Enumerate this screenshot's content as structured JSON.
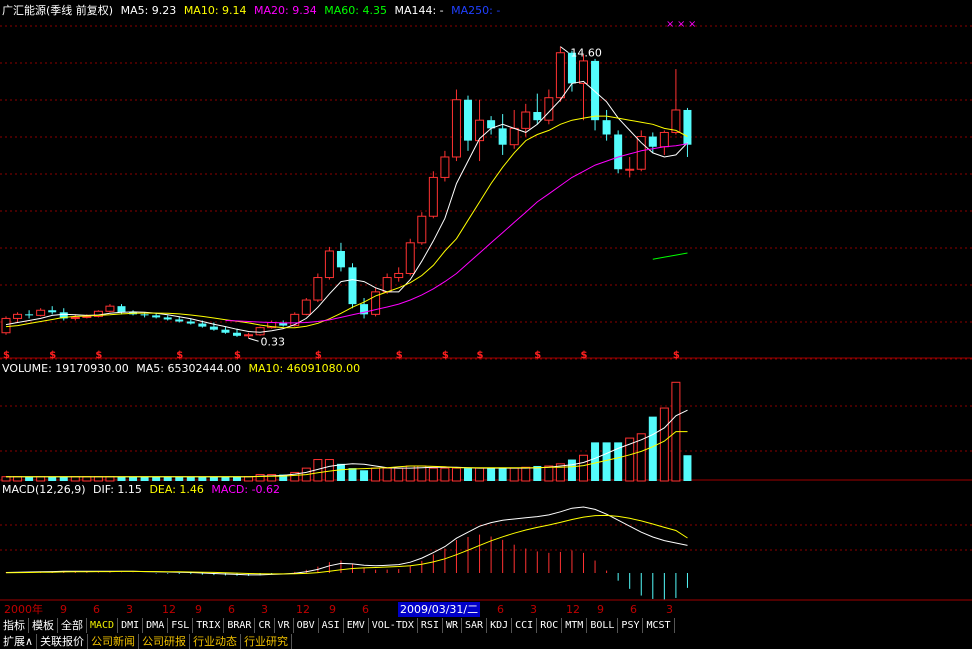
{
  "price_header": {
    "title": "广汇能源(季线 前复权)",
    "ma5": "MA5: 9.23",
    "ma10": "MA10: 9.14",
    "ma20": "MA20: 9.34",
    "ma60": "MA60: 4.35",
    "ma144": "MA144: -",
    "ma250": "MA250: -"
  },
  "volume_header": {
    "volume": "VOLUME: 19170930.00",
    "ma5": "MA5: 65302444.00",
    "ma10": "MA10: 46091080.00"
  },
  "macd_header": {
    "name": "MACD(12,26,9)",
    "dif": "DIF: 1.15",
    "dea": "DEA: 1.46",
    "macd": "MACD: -0.62"
  },
  "annotations": {
    "high": "14.60",
    "low": "0.33"
  },
  "colors": {
    "up": "#ff3232",
    "down": "#54fcfc",
    "ma5": "#ffffff",
    "ma10": "#ffff00",
    "ma20": "#ff00ff",
    "ma60": "#00ff00",
    "ma144": "#c0c0c0",
    "ma250": "#2040ff",
    "grid": "#8b0000",
    "timelabel": "#c00000"
  },
  "time_axis": {
    "labels": [
      "2000年",
      "9",
      "6",
      "3",
      "12",
      "9",
      "6",
      "3",
      "12",
      "9",
      "6",
      "6",
      "3",
      "12",
      "9",
      "6",
      "3"
    ],
    "cursor": "2009/03/31/二"
  },
  "indicator_tabs": [
    "指标",
    "模板",
    "全部",
    "MACD",
    "DMI",
    "DMA",
    "FSL",
    "TRIX",
    "BRAR",
    "CR",
    "VR",
    "OBV",
    "ASI",
    "EMV",
    "VOL-TDX",
    "RSI",
    "WR",
    "SAR",
    "KDJ",
    "CCI",
    "ROC",
    "MTM",
    "BOLL",
    "PSY",
    "MCST"
  ],
  "active_tab": "MACD",
  "bottom_tabs": [
    "扩展∧",
    "关联报价",
    "公司新闻",
    "公司研报",
    "行业动态",
    "行业研究"
  ],
  "chart_data": {
    "type": "candlestick",
    "period": "quarterly",
    "y_range": [
      0,
      16
    ],
    "candles": [
      {
        "o": 0.6,
        "h": 1.4,
        "l": 0.5,
        "c": 1.3
      },
      {
        "o": 1.3,
        "h": 1.6,
        "l": 1.1,
        "c": 1.5
      },
      {
        "o": 1.5,
        "h": 1.7,
        "l": 1.3,
        "c": 1.45
      },
      {
        "o": 1.45,
        "h": 1.8,
        "l": 1.4,
        "c": 1.7
      },
      {
        "o": 1.7,
        "h": 1.9,
        "l": 1.5,
        "c": 1.6
      },
      {
        "o": 1.6,
        "h": 1.8,
        "l": 1.2,
        "c": 1.3
      },
      {
        "o": 1.3,
        "h": 1.5,
        "l": 1.2,
        "c": 1.35
      },
      {
        "o": 1.35,
        "h": 1.5,
        "l": 1.3,
        "c": 1.4
      },
      {
        "o": 1.4,
        "h": 1.7,
        "l": 1.35,
        "c": 1.65
      },
      {
        "o": 1.65,
        "h": 2.0,
        "l": 1.6,
        "c": 1.9
      },
      {
        "o": 1.9,
        "h": 2.0,
        "l": 1.5,
        "c": 1.6
      },
      {
        "o": 1.6,
        "h": 1.7,
        "l": 1.45,
        "c": 1.5
      },
      {
        "o": 1.5,
        "h": 1.6,
        "l": 1.35,
        "c": 1.45
      },
      {
        "o": 1.45,
        "h": 1.55,
        "l": 1.3,
        "c": 1.35
      },
      {
        "o": 1.35,
        "h": 1.45,
        "l": 1.2,
        "c": 1.25
      },
      {
        "o": 1.25,
        "h": 1.4,
        "l": 1.1,
        "c": 1.15
      },
      {
        "o": 1.15,
        "h": 1.3,
        "l": 1.0,
        "c": 1.05
      },
      {
        "o": 1.05,
        "h": 1.2,
        "l": 0.85,
        "c": 0.9
      },
      {
        "o": 0.9,
        "h": 1.1,
        "l": 0.7,
        "c": 0.75
      },
      {
        "o": 0.75,
        "h": 0.9,
        "l": 0.55,
        "c": 0.6
      },
      {
        "o": 0.6,
        "h": 0.8,
        "l": 0.4,
        "c": 0.45
      },
      {
        "o": 0.45,
        "h": 0.6,
        "l": 0.33,
        "c": 0.5
      },
      {
        "o": 0.5,
        "h": 0.9,
        "l": 0.45,
        "c": 0.85
      },
      {
        "o": 0.85,
        "h": 1.2,
        "l": 0.8,
        "c": 1.1
      },
      {
        "o": 1.1,
        "h": 1.2,
        "l": 0.9,
        "c": 0.95
      },
      {
        "o": 0.95,
        "h": 1.6,
        "l": 0.9,
        "c": 1.5
      },
      {
        "o": 1.5,
        "h": 2.3,
        "l": 1.45,
        "c": 2.2
      },
      {
        "o": 2.2,
        "h": 3.5,
        "l": 2.1,
        "c": 3.3
      },
      {
        "o": 3.3,
        "h": 4.8,
        "l": 3.2,
        "c": 4.6
      },
      {
        "o": 4.6,
        "h": 5.0,
        "l": 3.6,
        "c": 3.8
      },
      {
        "o": 3.8,
        "h": 4.0,
        "l": 1.8,
        "c": 2.0
      },
      {
        "o": 2.0,
        "h": 2.3,
        "l": 1.3,
        "c": 1.5
      },
      {
        "o": 1.5,
        "h": 2.8,
        "l": 1.4,
        "c": 2.6
      },
      {
        "o": 2.6,
        "h": 3.5,
        "l": 2.5,
        "c": 3.3
      },
      {
        "o": 3.3,
        "h": 3.8,
        "l": 3.1,
        "c": 3.5
      },
      {
        "o": 3.5,
        "h": 5.2,
        "l": 3.4,
        "c": 5.0
      },
      {
        "o": 5.0,
        "h": 6.5,
        "l": 4.9,
        "c": 6.3
      },
      {
        "o": 6.3,
        "h": 8.5,
        "l": 6.2,
        "c": 8.2
      },
      {
        "o": 8.2,
        "h": 9.5,
        "l": 8.0,
        "c": 9.2
      },
      {
        "o": 9.2,
        "h": 12.5,
        "l": 9.0,
        "c": 12.0
      },
      {
        "o": 12.0,
        "h": 12.2,
        "l": 9.5,
        "c": 10.0
      },
      {
        "o": 10.0,
        "h": 12.0,
        "l": 9.0,
        "c": 11.0
      },
      {
        "o": 11.0,
        "h": 11.2,
        "l": 10.3,
        "c": 10.6
      },
      {
        "o": 10.6,
        "h": 11.3,
        "l": 9.3,
        "c": 9.8
      },
      {
        "o": 9.8,
        "h": 11.5,
        "l": 9.6,
        "c": 10.6
      },
      {
        "o": 10.6,
        "h": 11.8,
        "l": 10.2,
        "c": 11.4
      },
      {
        "o": 11.4,
        "h": 12.3,
        "l": 10.8,
        "c": 11.0
      },
      {
        "o": 11.0,
        "h": 12.5,
        "l": 10.8,
        "c": 12.1
      },
      {
        "o": 12.1,
        "h": 14.6,
        "l": 11.9,
        "c": 14.3
      },
      {
        "o": 14.3,
        "h": 14.4,
        "l": 12.4,
        "c": 12.8
      },
      {
        "o": 12.8,
        "h": 14.2,
        "l": 11.0,
        "c": 13.9
      },
      {
        "o": 13.9,
        "h": 14.0,
        "l": 10.5,
        "c": 11.0
      },
      {
        "o": 11.0,
        "h": 11.5,
        "l": 10.0,
        "c": 10.3
      },
      {
        "o": 10.3,
        "h": 10.5,
        "l": 8.4,
        "c": 8.6
      },
      {
        "o": 8.6,
        "h": 9.2,
        "l": 8.2,
        "c": 8.6
      },
      {
        "o": 8.6,
        "h": 10.5,
        "l": 8.5,
        "c": 10.2
      },
      {
        "o": 10.2,
        "h": 10.4,
        "l": 9.4,
        "c": 9.7
      },
      {
        "o": 9.7,
        "h": 10.5,
        "l": 9.3,
        "c": 10.4
      },
      {
        "o": 10.4,
        "h": 13.5,
        "l": 10.3,
        "c": 11.5
      },
      {
        "o": 11.5,
        "h": 11.6,
        "l": 9.2,
        "c": 9.8
      }
    ],
    "ma5": [
      1.0,
      1.1,
      1.2,
      1.3,
      1.45,
      1.5,
      1.48,
      1.45,
      1.47,
      1.55,
      1.6,
      1.62,
      1.6,
      1.55,
      1.48,
      1.38,
      1.28,
      1.15,
      1.02,
      0.9,
      0.77,
      0.66,
      0.62,
      0.7,
      0.8,
      1.0,
      1.3,
      1.85,
      2.5,
      3.1,
      3.2,
      3.1,
      2.8,
      2.6,
      2.6,
      3.2,
      4.1,
      5.1,
      6.2,
      7.9,
      9.0,
      10.1,
      10.6,
      10.8,
      10.6,
      10.4,
      10.8,
      11.4,
      12.0,
      12.8,
      12.9,
      12.4,
      11.9,
      11.1,
      10.5,
      9.9,
      9.4,
      9.2,
      9.3,
      9.9
    ],
    "ma10": [
      0.9,
      0.95,
      1.05,
      1.15,
      1.25,
      1.35,
      1.4,
      1.42,
      1.45,
      1.48,
      1.52,
      1.55,
      1.56,
      1.56,
      1.55,
      1.52,
      1.47,
      1.4,
      1.32,
      1.24,
      1.16,
      1.08,
      0.98,
      0.9,
      0.85,
      0.84,
      0.92,
      1.06,
      1.28,
      1.55,
      1.85,
      2.1,
      2.4,
      2.6,
      2.8,
      3.05,
      3.4,
      3.9,
      4.6,
      5.2,
      6.1,
      7.0,
      7.9,
      8.7,
      9.4,
      10.0,
      10.3,
      10.5,
      10.8,
      11.0,
      11.1,
      11.2,
      11.2,
      11.1,
      11.0,
      10.9,
      10.8,
      10.6,
      10.5,
      10.2
    ],
    "ma20": [
      null,
      null,
      null,
      null,
      null,
      null,
      null,
      null,
      null,
      null,
      null,
      null,
      null,
      null,
      null,
      null,
      null,
      null,
      null,
      1.2,
      1.18,
      1.15,
      1.12,
      1.1,
      1.08,
      1.08,
      1.1,
      1.15,
      1.23,
      1.35,
      1.48,
      1.6,
      1.73,
      1.86,
      2.0,
      2.2,
      2.45,
      2.75,
      3.1,
      3.5,
      4.0,
      4.5,
      5.0,
      5.5,
      6.0,
      6.5,
      7.0,
      7.4,
      7.8,
      8.2,
      8.5,
      8.8,
      9.0,
      9.2,
      9.35,
      9.5,
      9.6,
      9.7,
      9.75,
      9.85
    ],
    "ma60": [
      null,
      null,
      null,
      null,
      null,
      null,
      null,
      null,
      null,
      null,
      null,
      null,
      null,
      null,
      null,
      null,
      null,
      null,
      null,
      null,
      null,
      null,
      null,
      null,
      null,
      null,
      null,
      null,
      null,
      null,
      null,
      null,
      null,
      null,
      null,
      null,
      null,
      null,
      null,
      null,
      null,
      null,
      null,
      null,
      null,
      null,
      null,
      null,
      null,
      null,
      null,
      null,
      null,
      null,
      null,
      null,
      4.2,
      4.3,
      4.4,
      4.5
    ],
    "volume": [
      1,
      1,
      1,
      1,
      1,
      1,
      1,
      1,
      1,
      1,
      1,
      1,
      1,
      1,
      1,
      1,
      1,
      1,
      1,
      1,
      1,
      1,
      1.5,
      1.5,
      1.5,
      2,
      3,
      5,
      5,
      4,
      3,
      2.5,
      3,
      3,
      3,
      3.5,
      3.5,
      3,
      3,
      3,
      3,
      3,
      3,
      3,
      3,
      3.2,
      3.5,
      3.5,
      4,
      5,
      6,
      9,
      9,
      9,
      10,
      11,
      15,
      17,
      23,
      6
    ],
    "vol_ma5": [
      1,
      1,
      1,
      1,
      1,
      1,
      1,
      1,
      1,
      1,
      1,
      1,
      1,
      1,
      1,
      1,
      1,
      1,
      1,
      1,
      1,
      1,
      1.1,
      1.2,
      1.3,
      1.6,
      2,
      2.7,
      3.4,
      3.8,
      4,
      3.9,
      3.5,
      3.1,
      3.0,
      3.0,
      3.1,
      3.2,
      3.2,
      3.2,
      3.1,
      3.0,
      3.0,
      3.0,
      3.0,
      3.0,
      3.1,
      3.2,
      3.5,
      3.8,
      4.3,
      5.3,
      6.4,
      7.6,
      8.6,
      9.6,
      10.8,
      12.4,
      15.2,
      16.5
    ],
    "vol_ma10": [
      1,
      1,
      1,
      1,
      1,
      1,
      1,
      1,
      1,
      1,
      1,
      1,
      1,
      1,
      1,
      1,
      1,
      1,
      1,
      1,
      1,
      1,
      1.05,
      1.1,
      1.15,
      1.3,
      1.5,
      1.9,
      2.3,
      2.6,
      2.8,
      2.9,
      3.0,
      3.1,
      3.3,
      3.5,
      3.5,
      3.4,
      3.3,
      3.1,
      3.1,
      3.1,
      3.1,
      3.1,
      3.1,
      3.1,
      3.1,
      3.2,
      3.2,
      3.3,
      3.6,
      4.2,
      4.8,
      5.4,
      6.1,
      6.9,
      8.0,
      9.3,
      11.5,
      11.5
    ],
    "dif": [
      0.02,
      0.03,
      0.04,
      0.05,
      0.06,
      0.07,
      0.07,
      0.07,
      0.07,
      0.07,
      0.07,
      0.07,
      0.06,
      0.05,
      0.04,
      0.03,
      0.02,
      0.0,
      -0.02,
      -0.04,
      -0.06,
      -0.08,
      -0.08,
      -0.06,
      -0.04,
      -0.01,
      0.05,
      0.15,
      0.3,
      0.4,
      0.38,
      0.32,
      0.3,
      0.32,
      0.35,
      0.45,
      0.62,
      0.85,
      1.1,
      1.45,
      1.7,
      1.95,
      2.1,
      2.2,
      2.25,
      2.3,
      2.35,
      2.42,
      2.55,
      2.7,
      2.75,
      2.65,
      2.45,
      2.2,
      1.95,
      1.7,
      1.5,
      1.35,
      1.25,
      1.15
    ],
    "dea": [
      0.01,
      0.015,
      0.02,
      0.03,
      0.035,
      0.045,
      0.05,
      0.055,
      0.06,
      0.06,
      0.065,
      0.065,
      0.062,
      0.06,
      0.055,
      0.05,
      0.043,
      0.035,
      0.024,
      0.011,
      -0.004,
      -0.02,
      -0.032,
      -0.038,
      -0.039,
      -0.033,
      -0.016,
      0.017,
      0.074,
      0.139,
      0.187,
      0.214,
      0.231,
      0.249,
      0.269,
      0.305,
      0.368,
      0.464,
      0.591,
      0.763,
      0.95,
      1.15,
      1.34,
      1.51,
      1.66,
      1.79,
      1.9,
      2.0,
      2.11,
      2.23,
      2.33,
      2.39,
      2.4,
      2.36,
      2.28,
      2.17,
      2.04,
      1.9,
      1.77,
      1.46
    ]
  }
}
